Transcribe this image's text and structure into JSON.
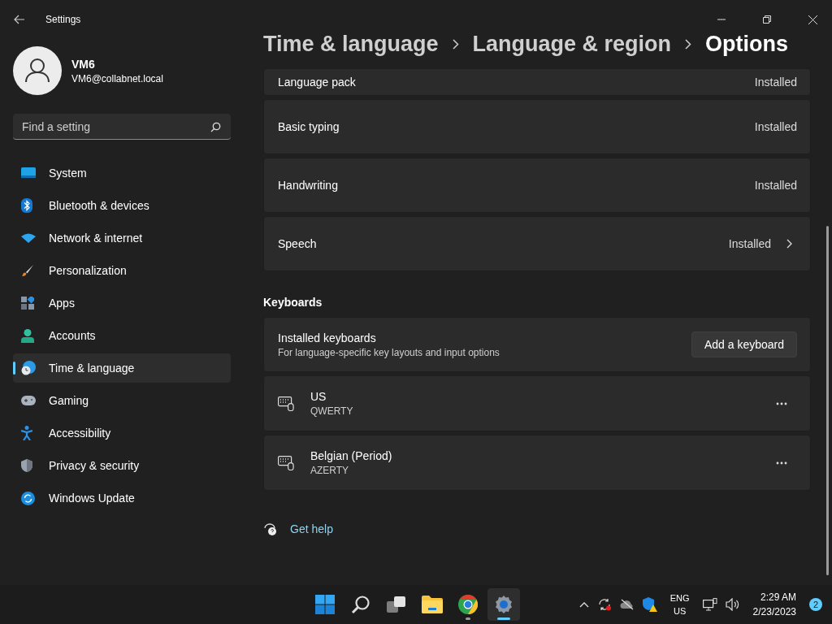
{
  "window": {
    "title": "Settings"
  },
  "user": {
    "name": "VM6",
    "email": "VM6@collabnet.local"
  },
  "search": {
    "placeholder": "Find a setting"
  },
  "nav": [
    {
      "label": "System",
      "kind": "system",
      "selected": false
    },
    {
      "label": "Bluetooth & devices",
      "kind": "bluetooth",
      "selected": false
    },
    {
      "label": "Network & internet",
      "kind": "network",
      "selected": false
    },
    {
      "label": "Personalization",
      "kind": "brush",
      "selected": false
    },
    {
      "label": "Apps",
      "kind": "apps",
      "selected": false
    },
    {
      "label": "Accounts",
      "kind": "accounts",
      "selected": false
    },
    {
      "label": "Time & language",
      "kind": "time",
      "selected": true
    },
    {
      "label": "Gaming",
      "kind": "gaming",
      "selected": false
    },
    {
      "label": "Accessibility",
      "kind": "accessibility",
      "selected": false
    },
    {
      "label": "Privacy & security",
      "kind": "shield",
      "selected": false
    },
    {
      "label": "Windows Update",
      "kind": "update",
      "selected": false
    }
  ],
  "breadcrumb": [
    "Time & language",
    "Language & region",
    "Options"
  ],
  "features": [
    {
      "label": "Language pack",
      "status": "Installed",
      "chevron": false
    },
    {
      "label": "Basic typing",
      "status": "Installed",
      "chevron": false
    },
    {
      "label": "Handwriting",
      "status": "Installed",
      "chevron": false
    },
    {
      "label": "Speech",
      "status": "Installed",
      "chevron": true
    }
  ],
  "keyboards": {
    "heading": "Keyboards",
    "title": "Installed keyboards",
    "subtitle": "For language-specific key layouts and input options",
    "button": "Add a keyboard",
    "list": [
      {
        "name": "US",
        "layout": "QWERTY"
      },
      {
        "name": "Belgian (Period)",
        "layout": "AZERTY"
      }
    ]
  },
  "help": {
    "label": "Get help"
  },
  "taskbar": {
    "apps": [
      {
        "kind": "start",
        "running": false,
        "selected": false
      },
      {
        "kind": "search",
        "running": false,
        "selected": false
      },
      {
        "kind": "taskview",
        "running": false,
        "selected": false
      },
      {
        "kind": "explorer",
        "running": false,
        "selected": false
      },
      {
        "kind": "chrome",
        "running": true,
        "selected": false
      },
      {
        "kind": "settings",
        "running": true,
        "selected": true
      }
    ],
    "language": "ENG",
    "region": "US",
    "time": "2:29 AM",
    "date": "2/23/2023",
    "notifications": "2"
  }
}
